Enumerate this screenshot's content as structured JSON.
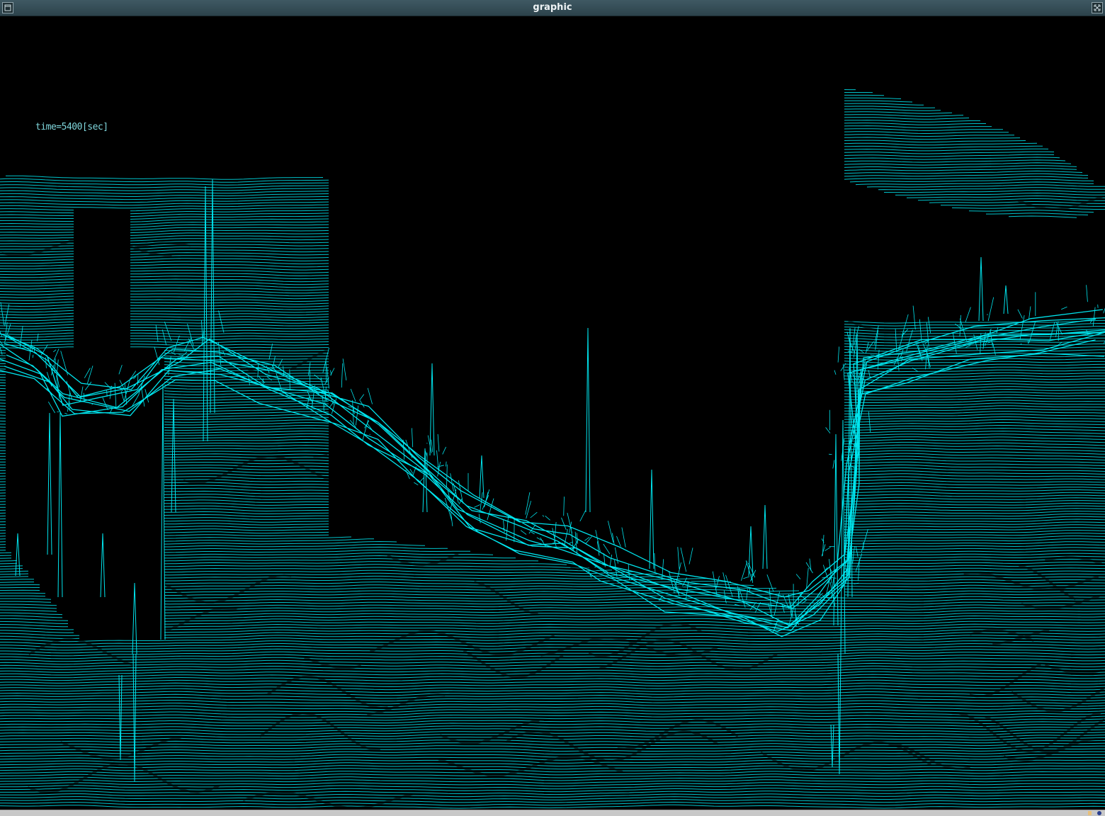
{
  "window": {
    "title": "graphic"
  },
  "overlay": {
    "time_label": "time=5400[sec]"
  },
  "icons": {
    "menu": "window-menu-icon",
    "fullscreen": "fullscreen-icon"
  },
  "colors": {
    "mesh_line": "#00e5ee",
    "background": "#000000",
    "titlebar": "#34505a"
  }
}
